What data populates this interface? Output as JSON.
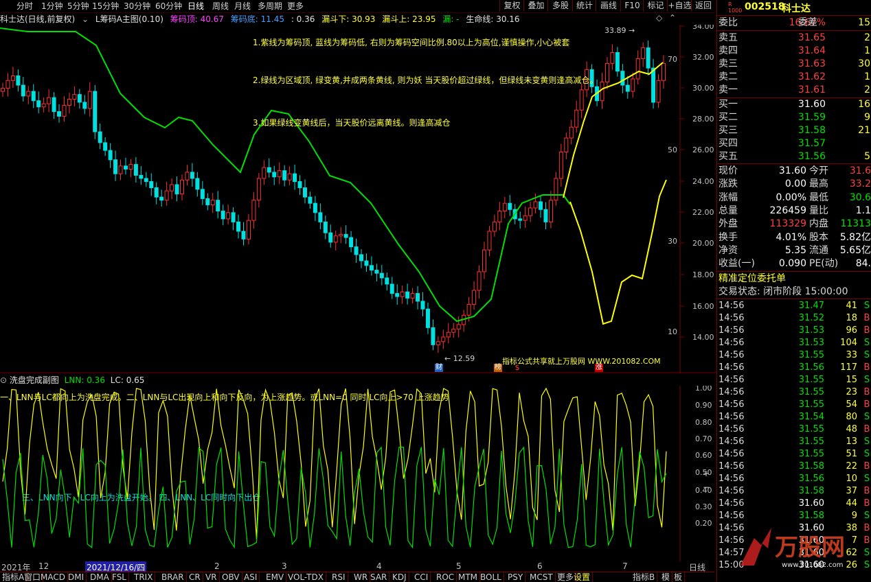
{
  "toolbar": {
    "periods": [
      "分时",
      "1分钟",
      "5分钟",
      "15分钟",
      "30分钟",
      "60分钟",
      "日线",
      "周线",
      "月线",
      "多周期",
      "更多"
    ],
    "active_period": "日线",
    "buttons": [
      "复权",
      "叠加",
      "多股",
      "统计",
      "画线",
      "F10",
      "标记",
      "+自选",
      "返回"
    ]
  },
  "title": {
    "name": "科士达(日线,前复权)",
    "indicator": "L筹码A主图(0.10)",
    "top_label": "筹码顶: 40.67",
    "bottom_label": "筹码底: 11.45",
    "ratio": ": 0.36",
    "funnel_down": "漏斗下: 30.93",
    "funnel_up": "漏斗上: 23.95",
    "leak": "漏: -",
    "lifeline": "生命线: 30.16"
  },
  "main_axis": {
    "price_ticks": [
      "34.00",
      "32.00",
      "30.00",
      "28.00",
      "26.00",
      "24.00",
      "22.00",
      "20.00",
      "18.00",
      "16.00",
      "14.00"
    ],
    "inner_ticks": [
      "70",
      "50",
      "30",
      "10"
    ]
  },
  "notes": [
    "1.紫线为筹码顶, 蓝线为筹码低, 右则为筹码空间比例.80以上为高位,谨慎操作,小心被套",
    "2.绿线为区域顶, 绿变黄,并成两条黄线, 则为妖 当天股价超过绿线，但绿线未变黄则逢高减仓。",
    "3.如果绿线变黄线后，当天股价远离黄线。则逢高减仓"
  ],
  "price_marks": {
    "high": "33.89",
    "low": "12.59"
  },
  "event_labels": [
    "财",
    "榜",
    "$",
    "涨"
  ],
  "watermark": "指标公式共享就上万股网 WWW.201082.COM",
  "sub_panel": {
    "name": "洗盘完成副图",
    "lnn": "LNN: 0.36",
    "lc": "LC: 0.65",
    "note1": "一、LNN与LC都向上为洗盘完成。二、LNN与LC出现向上和向下反向，为上涨趋势。或LNN=0 同时 LC向上>70 上涨趋势",
    "note2": "三、LNN向下，LC向上为洗盘开始。 四、LNN、LC同时向下出仓",
    "ticks": [
      "1.00",
      "0.90",
      "0.80",
      "0.70",
      "0.60",
      "0.50",
      "0.40",
      "0.30",
      "0.20"
    ]
  },
  "date_bar": {
    "year": "2021年",
    "months": [
      "12",
      "2",
      "3",
      "4",
      "5",
      "6",
      "7"
    ],
    "selected": "2021/12/16/四",
    "right_label": "日线"
  },
  "bottom_tabs": [
    "指标A",
    "窗口",
    "MACD",
    "DMI",
    "DMA",
    "FSL",
    "TRIX",
    "BRAR",
    "CR",
    "VR",
    "OBV",
    "ASI",
    "EMV",
    "VOL-TDX",
    "RSI",
    "WR",
    "SAR",
    "KDJ",
    "CCI",
    "ROC",
    "MTM",
    "BOLL",
    "PSY",
    "MCST",
    "更多",
    "设置"
  ],
  "bottom_right": [
    "指标B",
    "模",
    "板"
  ],
  "quote": {
    "code": "002518",
    "name": "科士达",
    "webi_label": "委比",
    "webi": "16.67%",
    "weicha_label": "委差",
    "weicha": "15",
    "asks": [
      {
        "label": "卖五",
        "price": "31.65",
        "vol": "2"
      },
      {
        "label": "卖四",
        "price": "31.64",
        "vol": "1"
      },
      {
        "label": "卖三",
        "price": "31.63",
        "vol": "30"
      },
      {
        "label": "卖二",
        "price": "31.62",
        "vol": "1"
      },
      {
        "label": "卖一",
        "price": "31.61",
        "vol": "2"
      }
    ],
    "bids": [
      {
        "label": "买一",
        "price": "31.60",
        "vol": "16"
      },
      {
        "label": "买二",
        "price": "31.59",
        "vol": "9"
      },
      {
        "label": "买三",
        "price": "31.58",
        "vol": "21"
      },
      {
        "label": "买四",
        "price": "31.57",
        "vol": ""
      },
      {
        "label": "买五",
        "price": "31.56",
        "vol": "5"
      }
    ],
    "stats": [
      {
        "l1": "现价",
        "v1": "31.60",
        "l2": "今开",
        "v2": "31.6"
      },
      {
        "l1": "涨跌",
        "v1": "0.00",
        "l2": "最高",
        "v2": "33.2"
      },
      {
        "l1": "涨幅",
        "v1": "0.00%",
        "l2": "最低",
        "v2": "30.6"
      },
      {
        "l1": "总量",
        "v1": "226459",
        "l2": "量比",
        "v2": "1.1"
      },
      {
        "l1": "外盘",
        "v1": "113329",
        "l2": "内盘",
        "v2": "11313"
      },
      {
        "l1": "换手",
        "v1": "4.01%",
        "l2": "股本",
        "v2": "5.82亿"
      },
      {
        "l1": "净资",
        "v1": "5.35",
        "l2": "流通",
        "v2": "5.65亿"
      },
      {
        "l1": "收益(一)",
        "v1": "0.090",
        "l2": "PE(动)",
        "v2": "84."
      }
    ],
    "section_title": "精准定位委托单",
    "trade_state": "交易状态: 闭市阶段 15:00:00",
    "ticks": [
      {
        "t": "14:56",
        "p": "31.47",
        "q": "41",
        "d": "S"
      },
      {
        "t": "14:56",
        "p": "31.52",
        "q": "18",
        "d": "B"
      },
      {
        "t": "14:56",
        "p": "31.53",
        "q": "96",
        "d": "B"
      },
      {
        "t": "14:56",
        "p": "31.53",
        "q": "104",
        "d": "S"
      },
      {
        "t": "14:56",
        "p": "31.55",
        "q": "33",
        "d": "S"
      },
      {
        "t": "14:56",
        "p": "31.56",
        "q": "117",
        "d": "B"
      },
      {
        "t": "14:56",
        "p": "31.55",
        "q": "15",
        "d": "S"
      },
      {
        "t": "14:56",
        "p": "31.55",
        "q": "23",
        "d": "B"
      },
      {
        "t": "14:56",
        "p": "31.55",
        "q": "54",
        "d": "B"
      },
      {
        "t": "14:56",
        "p": "31.54",
        "q": "80",
        "d": "S"
      },
      {
        "t": "14:56",
        "p": "31.55",
        "q": "48",
        "d": "B"
      },
      {
        "t": "14:56",
        "p": "31.55",
        "q": "13",
        "d": "S"
      },
      {
        "t": "14:56",
        "p": "31.55",
        "q": "51",
        "d": "S"
      },
      {
        "t": "14:56",
        "p": "31.58",
        "q": "22",
        "d": "B"
      },
      {
        "t": "14:56",
        "p": "31.56",
        "q": "10",
        "d": "S"
      },
      {
        "t": "14:56",
        "p": "31.58",
        "q": "37",
        "d": "B"
      },
      {
        "t": "14:56",
        "p": "31.60",
        "q": "44",
        "d": "B"
      },
      {
        "t": "14:56",
        "p": "31.58",
        "q": "9",
        "d": "S"
      },
      {
        "t": "14:56",
        "p": "31.60",
        "q": "38",
        "d": "B"
      },
      {
        "t": "14:56",
        "p": "31.60",
        "q": "7",
        "d": "B"
      },
      {
        "t": "14:57",
        "p": "31.60",
        "q": "62",
        "d": "S"
      },
      {
        "t": "15:00",
        "p": "31.60",
        "q": "26",
        "d": "S"
      }
    ]
  }
}
